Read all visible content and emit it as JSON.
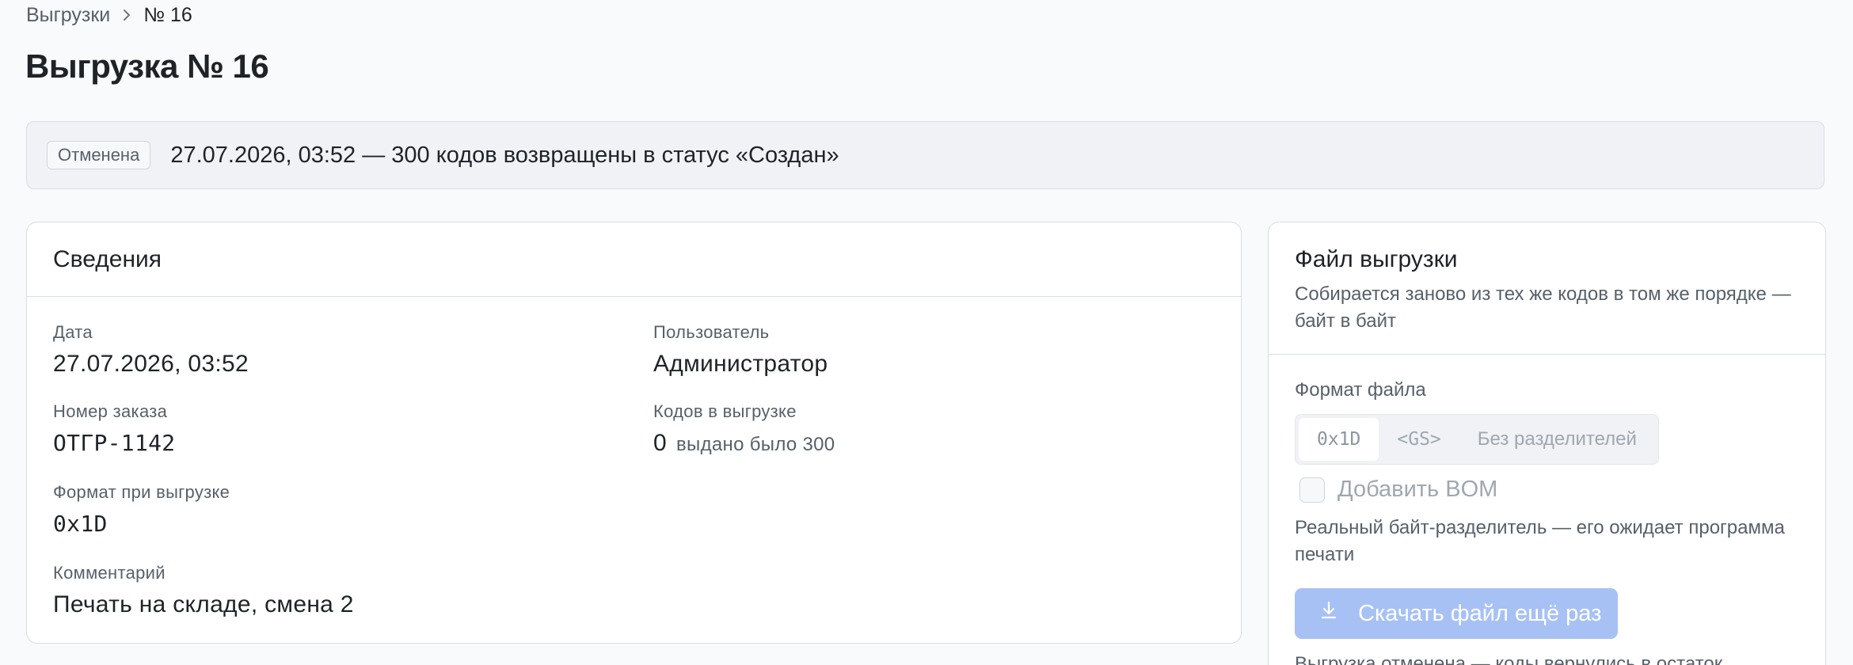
{
  "breadcrumb": {
    "parent": "Выгрузки",
    "separator_icon": "chevron-right-icon",
    "current": "№ 16"
  },
  "page": {
    "title": "Выгрузка № 16"
  },
  "status_banner": {
    "badge": "Отменена",
    "text": "27.07.2026, 03:52 — 300 кодов возвращены в статус «Создан»"
  },
  "info_card": {
    "title": "Сведения",
    "date": {
      "label": "Дата",
      "value": "27.07.2026, 03:52"
    },
    "user": {
      "label": "Пользователь",
      "value": "Администратор"
    },
    "order": {
      "label": "Номер заказа",
      "value": "ОТГР-1142"
    },
    "codes": {
      "label": "Кодов в выгрузке",
      "value": "0",
      "sub": "выдано было 300"
    },
    "format": {
      "label": "Формат при выгрузке",
      "value": "0x1D"
    },
    "comment": {
      "label": "Комментарий",
      "value": "Печать на складе, смена 2"
    }
  },
  "file_card": {
    "title": "Файл выгрузки",
    "description": "Собирается заново из тех же кодов в том же порядке — байт в байт",
    "format_label": "Формат файла",
    "format_options": [
      "0x1D",
      "<GS>",
      "Без разделителей"
    ],
    "format_selected": "0x1D",
    "bom_label": "Добавить BOM",
    "bom_checked": false,
    "hint": "Реальный байт-разделитель — его ожидает программа печати",
    "download_label": "Скачать файл ещё раз",
    "download_icon": "download-icon",
    "footer_note": "Выгрузка отменена — коды вернулись в остаток"
  },
  "colors": {
    "accent_disabled": "#a7c1f5",
    "banner_bg": "#f0f2f5",
    "muted_text": "#57606a"
  }
}
